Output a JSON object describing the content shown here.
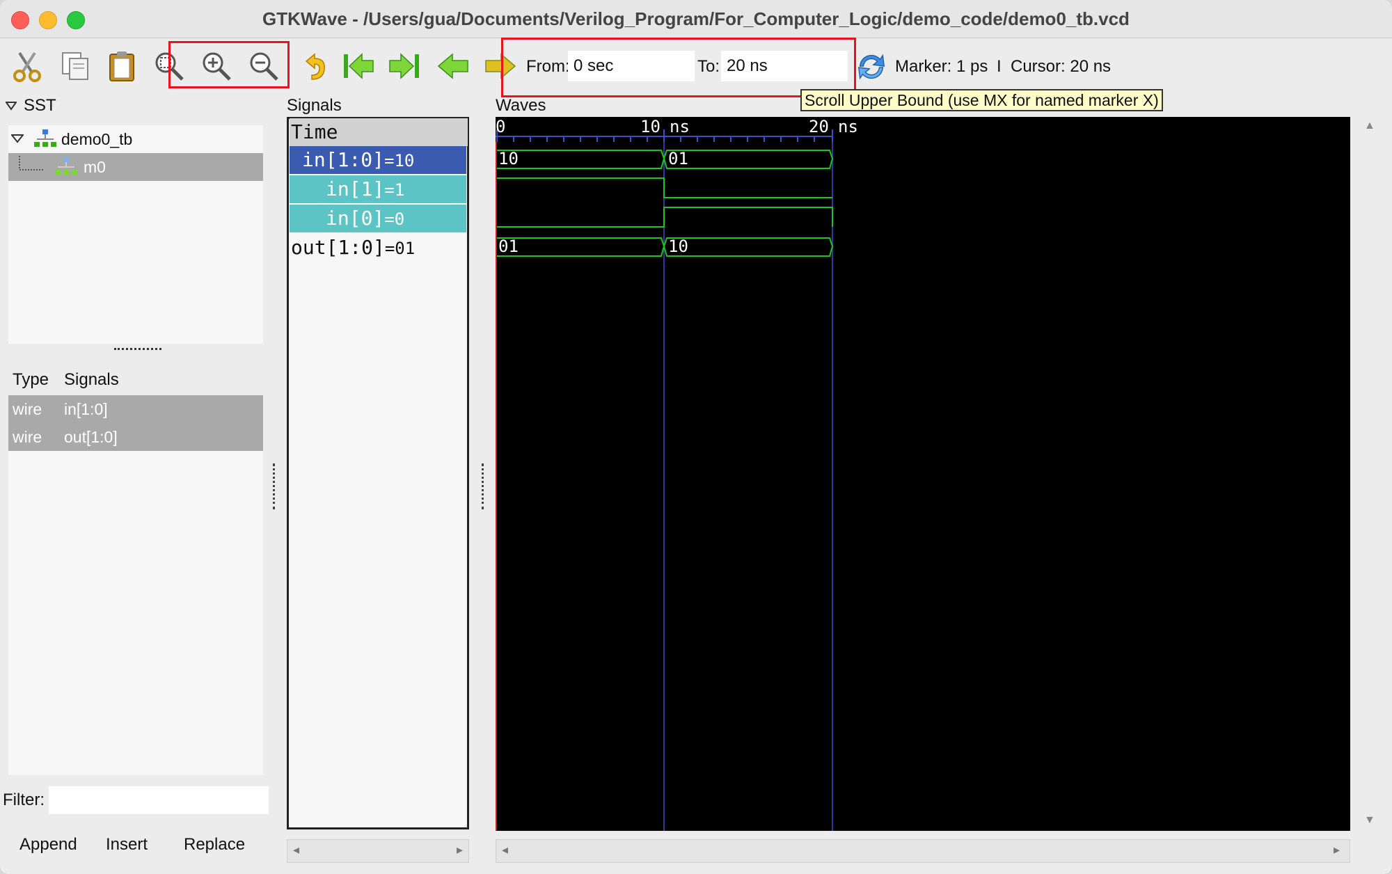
{
  "window": {
    "title": "GTKWave - /Users/gua/Documents/Verilog_Program/For_Computer_Logic/demo_code/demo0_tb.vcd"
  },
  "toolbar": {
    "icons": [
      "cut-icon",
      "copy-icon",
      "paste-icon",
      "zoom-fit-icon",
      "zoom-in-icon",
      "zoom-out-icon",
      "undo-icon",
      "jump-start-icon",
      "jump-end-icon",
      "prev-edge-icon",
      "next-edge-icon",
      "reload-icon"
    ],
    "from_label": "From:",
    "from_value": "0 sec",
    "to_label": "To:",
    "to_value": "20 ns",
    "marker_text": "Marker: 1 ps",
    "separator": "I",
    "cursor_text": "Cursor: 20 ns",
    "tooltip": "Scroll Upper Bound (use MX for named marker X)"
  },
  "sst": {
    "label": "SST",
    "tree": [
      {
        "name": "demo0_tb",
        "expanded": true
      },
      {
        "name": "m0",
        "selected": true
      }
    ],
    "table_headers": [
      "Type",
      "Signals"
    ],
    "rows": [
      {
        "type": "wire",
        "signal": "in[1:0]"
      },
      {
        "type": "wire",
        "signal": "out[1:0]"
      }
    ],
    "filter_label": "Filter:",
    "filter_value": "",
    "buttons": [
      "Append",
      "Insert",
      "Replace"
    ]
  },
  "signals": {
    "label": "Signals",
    "header": "Time",
    "items": [
      {
        "name": "in[1:0]",
        "value": "=10"
      },
      {
        "name": "in[1]",
        "value": "=1"
      },
      {
        "name": "in[0]",
        "value": "=0"
      },
      {
        "name": "out[1:0]",
        "value": "=01"
      }
    ]
  },
  "waves": {
    "label": "Waves",
    "ticks": [
      "0",
      "10",
      "ns",
      "20",
      "ns"
    ],
    "bus_values": {
      "in_bus": [
        "10",
        "01"
      ],
      "out_bus": [
        "01",
        "10"
      ]
    }
  },
  "colors": {
    "accent_red": "#e8141c",
    "wave_green": "#21c321",
    "wave_bg": "#000000",
    "selected_signal": "#3a5bb0",
    "child_signal": "#5cc4c4",
    "tooltip_bg": "#fdfbc8"
  }
}
